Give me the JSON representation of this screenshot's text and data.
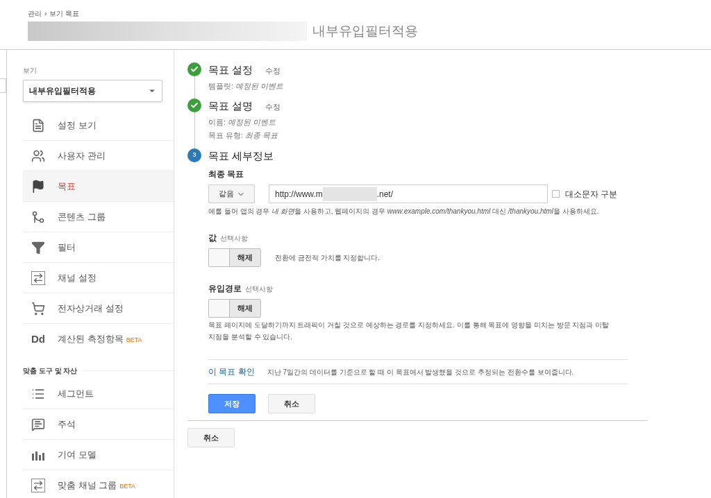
{
  "breadcrumb": {
    "items": [
      "관리",
      "보기 목표"
    ],
    "separator": "›"
  },
  "title": {
    "visible_text": "내부유입필터적용"
  },
  "sidebar": {
    "view_label": "보기",
    "view_select": "내부유입필터적용",
    "items": [
      {
        "kind": "file",
        "label": "설정 보기",
        "selected": false
      },
      {
        "kind": "users",
        "label": "사용자 관리",
        "selected": false
      },
      {
        "kind": "flag",
        "label": "목표",
        "selected": true
      },
      {
        "kind": "merge",
        "label": "콘텐츠 그룹",
        "selected": false
      },
      {
        "kind": "filter",
        "label": "필터",
        "selected": false
      },
      {
        "kind": "channel",
        "label": "채널 설정",
        "selected": false
      },
      {
        "kind": "cart",
        "label": "전자상거래 설정",
        "selected": false
      },
      {
        "kind": "text",
        "icon_text": "Dd",
        "label": "계산된 측정항목",
        "badge": "BETA",
        "selected": false
      }
    ],
    "section_title": "맞춤 도구 및 자산",
    "section_items": [
      {
        "kind": "segment",
        "label": "세그먼트",
        "selected": false
      },
      {
        "kind": "comment",
        "label": "주석",
        "selected": false
      },
      {
        "kind": "bars",
        "label": "기여 모델",
        "selected": false
      },
      {
        "kind": "channel",
        "label": "맞춤 채널 그룹",
        "badge": "BETA",
        "selected": false
      }
    ]
  },
  "steps": [
    {
      "kind": "done",
      "title": "목표 설정",
      "edit": "수정",
      "details": [
        {
          "label": "템플릿:",
          "value": "예정된 이벤트"
        }
      ]
    },
    {
      "kind": "done",
      "title": "목표 설명",
      "edit": "수정",
      "details": [
        {
          "label": "이름:",
          "value": "예정된 이벤트"
        },
        {
          "label": "목표 유형:",
          "value": "최종 목표"
        }
      ]
    },
    {
      "kind": "current",
      "number": "3",
      "title": "목표 세부정보"
    }
  ],
  "destination": {
    "label": "최종 목표",
    "match": "같음",
    "url_start": "http://www.m",
    "url_end": ".net/",
    "case_checkbox": {
      "label": "대소문자 구분",
      "checked": false
    },
    "hint": [
      {
        "text": "예를 들어 앱의 경우 ",
        "italic": false
      },
      {
        "text": "내 화면",
        "italic": true
      },
      {
        "text": "을 사용하고, 웹페이지의 경우 ",
        "italic": false
      },
      {
        "text": "www.example.com/thankyou.html",
        "italic": true
      },
      {
        "text": " 대신 ",
        "italic": false
      },
      {
        "text": "/thankyou.html",
        "italic": true
      },
      {
        "text": "을 사용하세요.",
        "italic": false
      }
    ]
  },
  "options": [
    {
      "label": "값",
      "optional": "선택사항",
      "toggle": {
        "on": false,
        "label": "해제"
      },
      "description": "전환에 금전적 가치를 지정합니다."
    },
    {
      "label": "유입경로",
      "optional": "선택사항",
      "toggle": {
        "on": false,
        "label": "해제"
      },
      "description": "목표 페이지에 도달하기까지 트래픽이 거칠 것으로 예상하는 경로를 지정하세요. 이를 통해 목표에 영향을 미치는 방문 지점과 이탈 지점을 분석할 수 있습니다."
    }
  ],
  "verify": {
    "link": "이 목표 확인",
    "description": "지난 7일간의 데이터를 기준으로 할 때 이 목표에서 발생했을 것으로 추정되는 전환수를 보여줍니다."
  },
  "buttons": {
    "save": "저장",
    "cancel": "취소"
  },
  "outer_cancel": "취소"
}
